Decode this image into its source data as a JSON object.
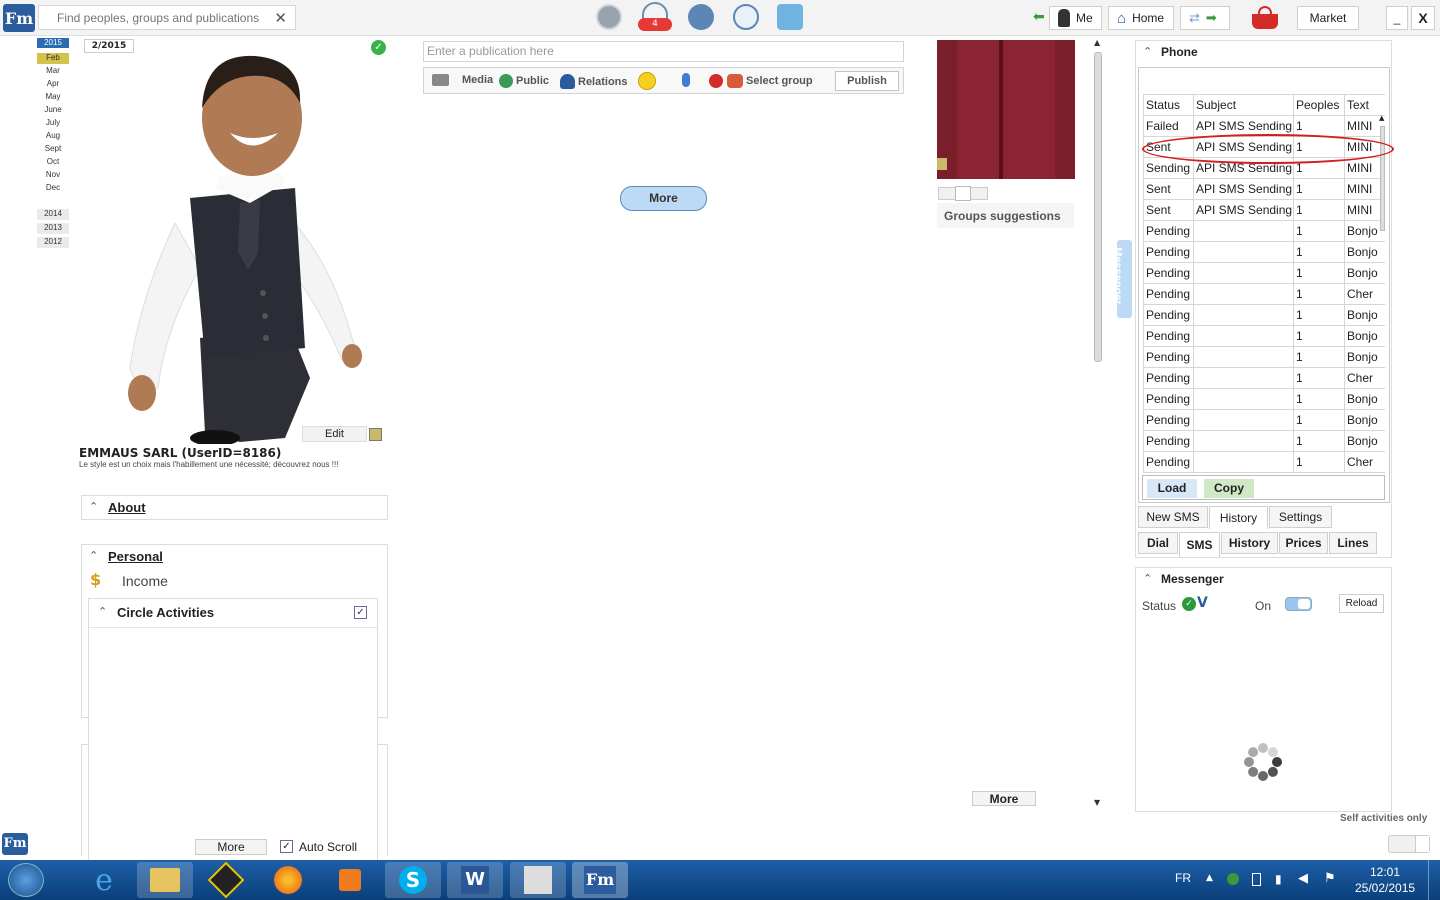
{
  "app": {
    "logo": "Fm"
  },
  "search": {
    "placeholder": "Find peoples, groups and publications",
    "clear": "✕"
  },
  "topbar": {
    "notif_count": "4",
    "me_label": "Me",
    "home_label": "Home",
    "market_label": "Market",
    "minimize": "_",
    "close": "X"
  },
  "timeline": {
    "year_current": "2015",
    "months": [
      "Feb",
      "Mar",
      "Apr",
      "May",
      "June",
      "July",
      "Aug",
      "Sept",
      "Oct",
      "Nov",
      "Dec"
    ],
    "years": [
      "2014",
      "2013",
      "2012"
    ],
    "date_badge": "2/2015"
  },
  "profile": {
    "edit_label": "Edit",
    "name": "EMMAUS SARL (UserID=8186)",
    "tagline": "Le style est un choix mais l'habillement une nécessité; découvrez nous !!!",
    "about_label": "About",
    "personal_label": "Personal",
    "income_label": "Income",
    "circle_label": "Circle Activities",
    "more_label": "More",
    "autoscroll_label": "Auto Scroll"
  },
  "publication": {
    "placeholder": "Enter a publication here",
    "media": "Media",
    "public": "Public",
    "relations": "Relations",
    "select_group": "Select group",
    "publish": "Publish",
    "more": "More"
  },
  "suggestions": {
    "groups_label": "Groups suggestions",
    "more": "More",
    "messenger_side": "Messenger",
    "self_activities": "Self activities only"
  },
  "phone": {
    "title": "Phone",
    "columns": [
      "Status",
      "Subject",
      "Peoples",
      "Text"
    ],
    "rows": [
      [
        "Failed",
        "API SMS Sending",
        "1",
        "MINI"
      ],
      [
        "Sent",
        "API SMS Sending",
        "1",
        "MINI"
      ],
      [
        "Sending",
        "API SMS Sending",
        "1",
        "MINI"
      ],
      [
        "Sent",
        "API SMS Sending",
        "1",
        "MINI"
      ],
      [
        "Sent",
        "API SMS Sending",
        "1",
        "MINI"
      ],
      [
        "Pending",
        "",
        "1",
        "Bonjo"
      ],
      [
        "Pending",
        "",
        "1",
        "Bonjo"
      ],
      [
        "Pending",
        "",
        "1",
        "Bonjo"
      ],
      [
        "Pending",
        "",
        "1",
        "Cher "
      ],
      [
        "Pending",
        "",
        "1",
        "Bonjo"
      ],
      [
        "Pending",
        "",
        "1",
        "Bonjo"
      ],
      [
        "Pending",
        "",
        "1",
        "Bonjo"
      ],
      [
        "Pending",
        "",
        "1",
        "Cher "
      ],
      [
        "Pending",
        "",
        "1",
        "Bonjo"
      ],
      [
        "Pending",
        "",
        "1",
        "Bonjo"
      ],
      [
        "Pending",
        "",
        "1",
        "Bonjo"
      ],
      [
        "Pending",
        "",
        "1",
        "Cher "
      ]
    ],
    "load": "Load",
    "copy": "Copy",
    "subtabs": [
      "New SMS",
      "History",
      "Settings"
    ],
    "tabs": [
      "Dial",
      "SMS",
      "History",
      "Prices",
      "Lines"
    ]
  },
  "messenger": {
    "title": "Messenger",
    "status_label": "Status",
    "on_label": "On",
    "reload": "Reload"
  },
  "taskbar": {
    "lang": "FR",
    "time": "12:01",
    "date": "25/02/2015"
  },
  "colors": {
    "accent_blue": "#2b5d9e",
    "highlight_oval": "#d11f1f",
    "load_btn": "#d8e8f8",
    "copy_btn": "#cfe9c6"
  }
}
